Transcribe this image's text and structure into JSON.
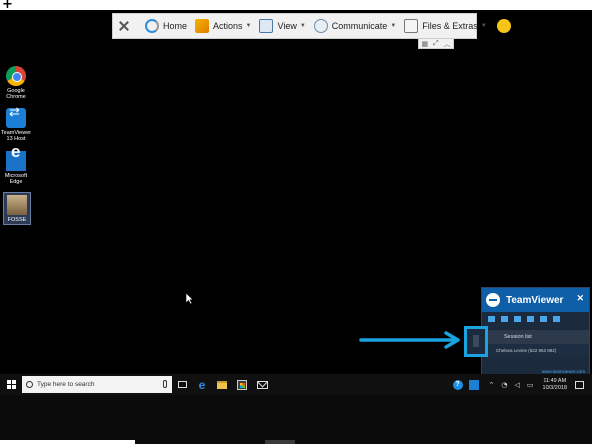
{
  "toolbar": {
    "home": "Home",
    "actions": "Actions",
    "view": "View",
    "communicate": "Communicate",
    "files": "Files & Extras"
  },
  "desktop_icons": [
    {
      "label_line1": "Google",
      "label_line2": "Chrome",
      "icon": "chrome-icon"
    },
    {
      "label_line1": "TeamViewer",
      "label_line2": "13 Host",
      "icon": "teamviewer-icon"
    },
    {
      "label_line1": "Microsoft",
      "label_line2": "Edge",
      "icon": "edge-icon"
    },
    {
      "label_line1": "FOSSE",
      "label_line2": "",
      "icon": "file-icon"
    }
  ],
  "tv_panel": {
    "title": "TeamViewer",
    "session_list": "Session list",
    "session_entry": "Chelsea Levine (622 963 882)",
    "url": "www.teamviewer.com"
  },
  "taskbar": {
    "search_placeholder": "Type here to search",
    "time": "11:49 AM",
    "date": "10/3/2018"
  },
  "colors": {
    "arrow": "#1aa3e0",
    "tv_blue": "#0e5fa8"
  }
}
